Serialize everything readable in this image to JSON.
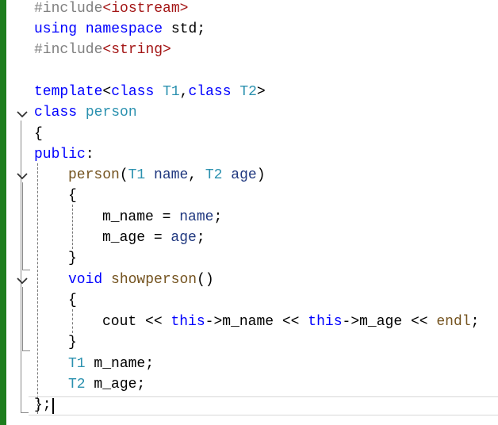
{
  "colors": {
    "change_bar": "#1e7d1e",
    "keyword": "#0000ff",
    "type": "#2b91af",
    "preprocessor": "#808080",
    "string": "#a31515",
    "function": "#74531f",
    "param": "#1f377f"
  },
  "code": {
    "l1": {
      "dir": "#include",
      "open": "<",
      "hdr": "iostream",
      "close": ">"
    },
    "l2": {
      "kw1": "using",
      "kw2": "namespace",
      "rest": " std;"
    },
    "l3": {
      "dir": "#include",
      "open": "<",
      "hdr": "string",
      "close": ">"
    },
    "l5": {
      "kw": "template",
      "open": "<",
      "c1": "class",
      "t1": "T1",
      "comma": ",",
      "c2": "class",
      "t2": "T2",
      "close": ">"
    },
    "l6": {
      "kw": "class",
      "name": "person"
    },
    "l7": {
      "brace": "{"
    },
    "l8": {
      "kw": "public",
      "colon": ":"
    },
    "l9": {
      "fn": "person",
      "p1": "(",
      "t1": "T1",
      "n1": " name",
      "c": ", ",
      "t2": "T2",
      "n2": " age",
      "p2": ")"
    },
    "l10": {
      "brace": "{"
    },
    "l11": {
      "lhs": "m_name",
      "eq": " = ",
      "rhs": "name",
      "semi": ";"
    },
    "l12": {
      "lhs": "m_age",
      "eq": " = ",
      "rhs": "age",
      "semi": ";"
    },
    "l13": {
      "brace": "}"
    },
    "l14": {
      "kw": "void",
      "fn": "showperson",
      "args": "()"
    },
    "l15": {
      "brace": "{"
    },
    "l16": {
      "cout": "cout",
      "op1": " << ",
      "this1": "this",
      "arrow1": "->",
      "f1": "m_name",
      "op2": " << ",
      "this2": "this",
      "arrow2": "->",
      "f2": "m_age",
      "op3": " << ",
      "endl": "endl",
      "semi": ";"
    },
    "l17": {
      "brace": "}"
    },
    "l18": {
      "type": "T1",
      "name": " m_name;"
    },
    "l19": {
      "type": "T2",
      "name": " m_age;"
    },
    "l20": {
      "text": "};"
    }
  }
}
